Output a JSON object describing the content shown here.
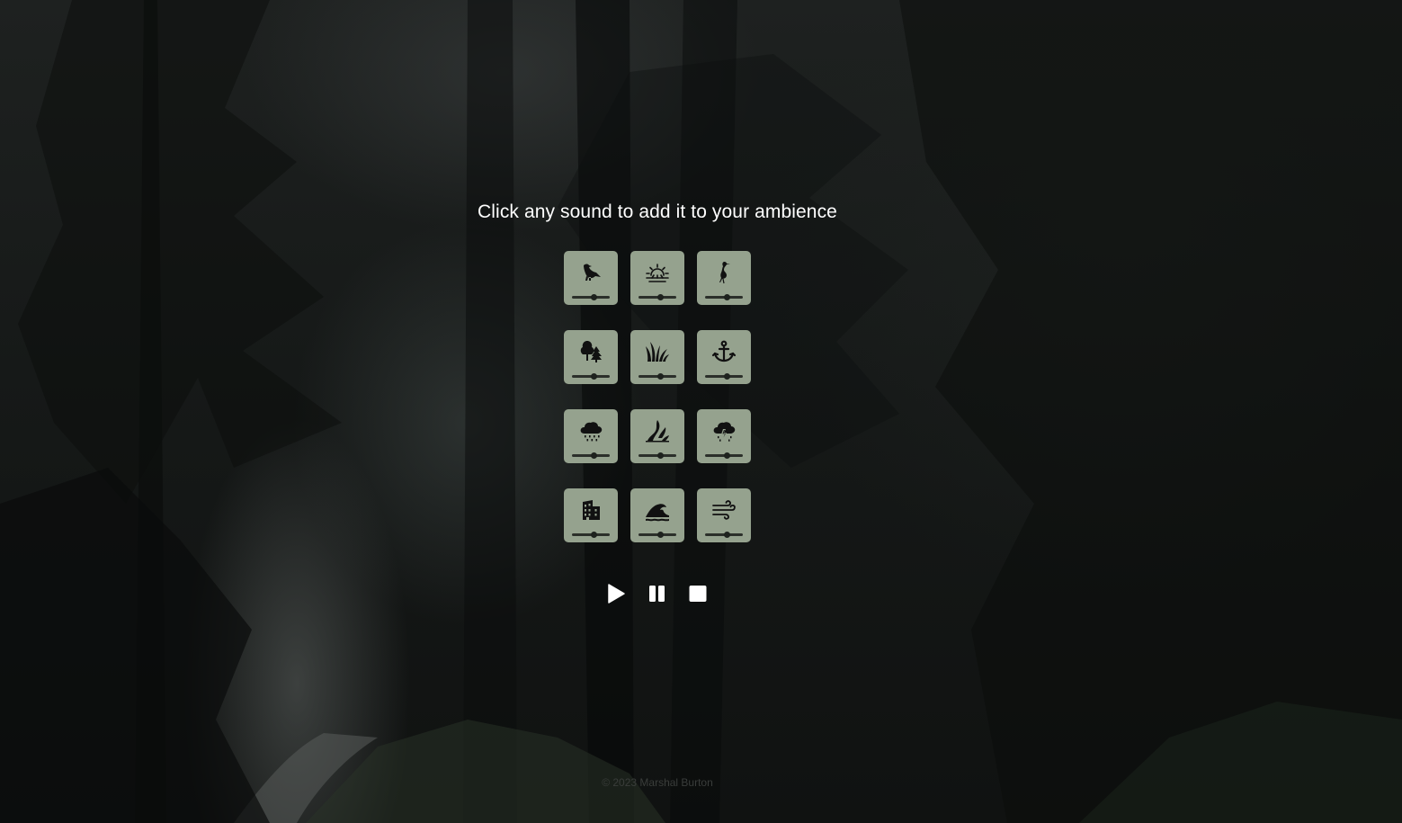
{
  "headline": "Click any sound to add it to your ambience",
  "sounds": [
    {
      "icon": "bird-icon",
      "volume": 0.5
    },
    {
      "icon": "sunrise-icon",
      "volume": 0.5
    },
    {
      "icon": "heron-icon",
      "volume": 0.5
    },
    {
      "icon": "trees-icon",
      "volume": 0.5
    },
    {
      "icon": "grass-icon",
      "volume": 0.5
    },
    {
      "icon": "anchor-icon",
      "volume": 0.5
    },
    {
      "icon": "rain-cloud-icon",
      "volume": 0.5
    },
    {
      "icon": "stream-icon",
      "volume": 0.5
    },
    {
      "icon": "thunderstorm-icon",
      "volume": 0.5
    },
    {
      "icon": "city-building-icon",
      "volume": 0.5
    },
    {
      "icon": "ocean-wave-icon",
      "volume": 0.5
    },
    {
      "icon": "wind-icon",
      "volume": 0.5
    }
  ],
  "controls": {
    "play": "play-icon",
    "pause": "pause-icon",
    "stop": "stop-icon"
  },
  "footer": "© 2023 Marshal Burton",
  "colors": {
    "tile": "#95a28e",
    "text": "#ffffff",
    "footer_text": "#3a3d3b"
  }
}
